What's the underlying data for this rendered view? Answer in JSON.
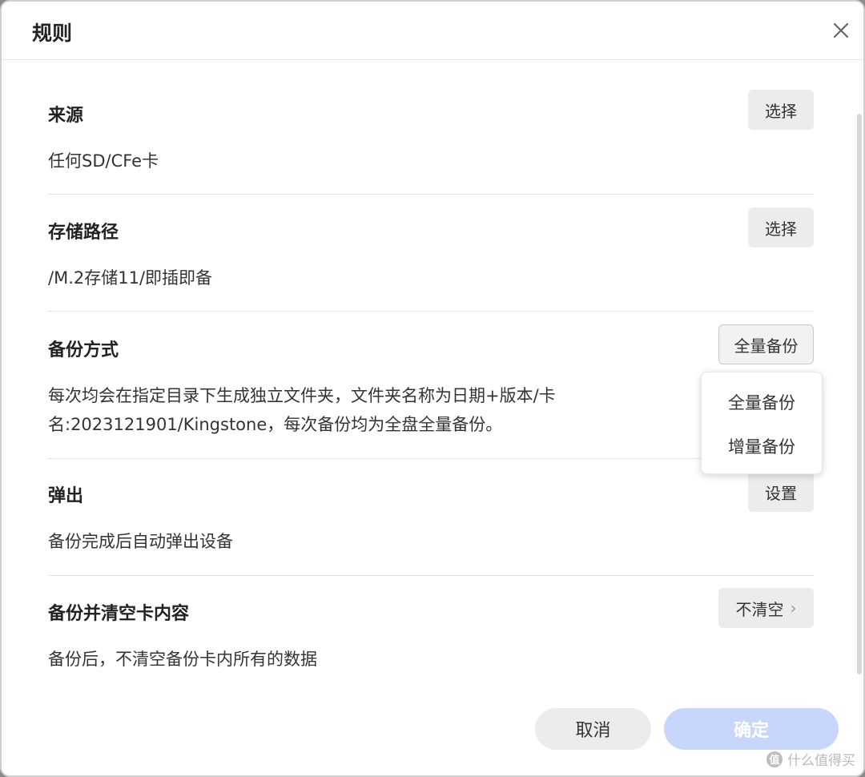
{
  "dialog": {
    "title": "规则",
    "close_icon": "close-icon"
  },
  "sections": {
    "source": {
      "label": "来源",
      "desc": "任何SD/CFe卡",
      "button": "选择"
    },
    "storage": {
      "label": "存储路径",
      "desc": "/M.2存储11/即插即备",
      "button": "选择"
    },
    "backup_mode": {
      "label": "备份方式",
      "desc_line1": "每次均会在指定目录下生成独立文件夹，文件夹名称为日期+版本/卡",
      "desc_line2": "名:2023121901/Kingstone，每次备份均为全盘全量备份。",
      "selected": "全量备份",
      "options": [
        "全量备份",
        "增量备份"
      ]
    },
    "eject": {
      "label": "弹出",
      "desc": "备份完成后自动弹出设备",
      "button": "设置"
    },
    "clear": {
      "label": "备份并清空卡内容",
      "desc": "备份后，不清空备份卡内所有的数据",
      "button": "不清空",
      "chevron": "›"
    }
  },
  "footer": {
    "cancel": "取消",
    "confirm": "确定"
  },
  "colors": {
    "confirm_bg": "#c9d6fb",
    "cancel_bg": "#ececee"
  },
  "watermark": {
    "logo": "值",
    "text": "什么值得买"
  }
}
